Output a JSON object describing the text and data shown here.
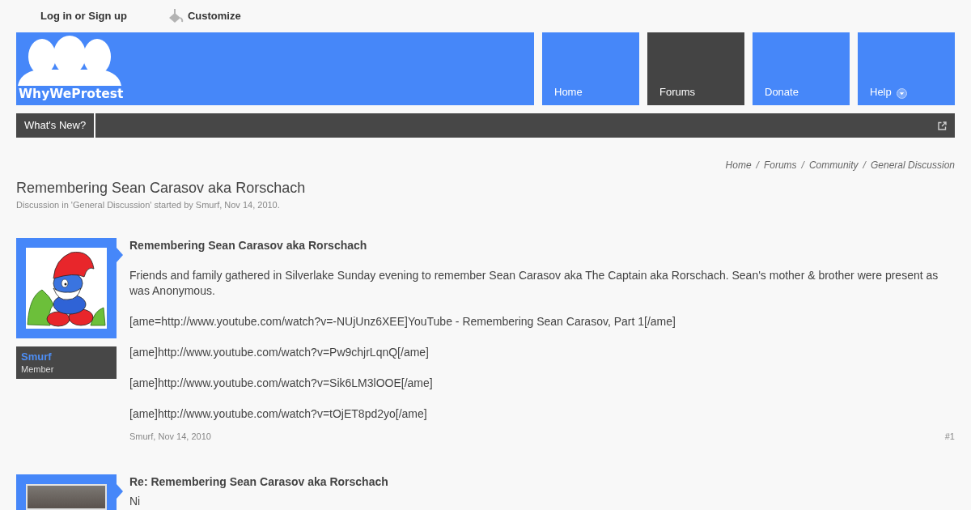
{
  "user_links": {
    "login": "Log in or Sign up",
    "customize": "Customize"
  },
  "header": {
    "logo_text": "WhyWeProtest"
  },
  "nav_tabs": [
    {
      "label": "Home",
      "selected": false,
      "dropdown": false
    },
    {
      "label": "Forums",
      "selected": true,
      "dropdown": false
    },
    {
      "label": "Donate",
      "selected": false,
      "dropdown": false
    },
    {
      "label": "Help",
      "selected": false,
      "dropdown": true
    }
  ],
  "subnav": {
    "label": "What's New?"
  },
  "breadcrumb": [
    {
      "label": "Home"
    },
    {
      "separator": "/",
      "label": "Forums"
    },
    {
      "separator": "/",
      "label": "Community"
    },
    {
      "separator": "/",
      "label": "General Discussion"
    }
  ],
  "thread": {
    "title": "Remembering Sean Carasov aka Rorschach",
    "meta": "Discussion in 'General Discussion' started by Smurf, Nov 14, 2010."
  },
  "posts": [
    {
      "avatar": {
        "kind": "cartoon"
      },
      "author": "Smurf",
      "role": "Member",
      "title": "Remembering Sean Carasov aka Rorschach",
      "paragraphs": [
        "Friends and family gathered in Silverlake Sunday evening to remember Sean Carasov aka The Captain aka Rorschach. Sean's mother & brother were present as was Anonymous.",
        "[ame=http://www.youtube.com/watch?v=-NUjUnz6XEE]YouTube - Remembering Sean Carasov, Part 1[/ame]",
        "[ame]http://www.youtube.com/watch?v=Pw9chjrLqnQ[/ame]",
        "[ame]http://www.youtube.com/watch?v=Sik6LM3lOOE[/ame]",
        "[ame]http://www.youtube.com/watch?v=tOjET8pd2yo[/ame]"
      ],
      "byline": "Smurf, Nov 14, 2010",
      "number": "#1"
    },
    {
      "avatar": {
        "kind": "photo"
      },
      "title": "Re: Remembering Sean Carasov aka Rorschach",
      "paragraphs": [
        "Ni"
      ]
    }
  ]
}
